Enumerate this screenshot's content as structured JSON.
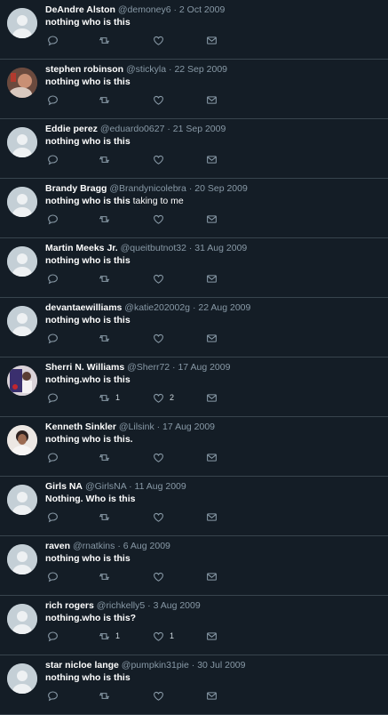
{
  "tweets": [
    {
      "name": "DeAndre Alston",
      "handle": "@demoney6",
      "date": "2 Oct 2009",
      "text_bold": "nothing who is this",
      "text_rest": "",
      "retweets": "",
      "likes": ""
    },
    {
      "name": "stephen robinson",
      "handle": "@stickyla",
      "date": "22 Sep 2009",
      "text_bold": "nothing who is this",
      "text_rest": "",
      "retweets": "",
      "likes": ""
    },
    {
      "name": "Eddie perez",
      "handle": "@eduardo0627",
      "date": "21 Sep 2009",
      "text_bold": "nothing who is this",
      "text_rest": "",
      "retweets": "",
      "likes": ""
    },
    {
      "name": "Brandy Bragg",
      "handle": "@Brandynicolebra",
      "date": "20 Sep 2009",
      "text_bold": "nothing who is this",
      "text_rest": " taking to me",
      "retweets": "",
      "likes": ""
    },
    {
      "name": "Martin Meeks Jr.",
      "handle": "@queitbutnot32",
      "date": "31 Aug 2009",
      "text_bold": "nothing who is this",
      "text_rest": "",
      "retweets": "",
      "likes": ""
    },
    {
      "name": "devantaewilliams",
      "handle": "@katie202002g",
      "date": "22 Aug 2009",
      "text_bold": "nothing who is this",
      "text_rest": "",
      "retweets": "",
      "likes": ""
    },
    {
      "name": "Sherri N. Williams",
      "handle": "@Sherr72",
      "date": "17 Aug 2009",
      "text_bold": "nothing.who is this",
      "text_rest": "",
      "retweets": "1",
      "likes": "2"
    },
    {
      "name": "Kenneth Sinkler",
      "handle": "@Lilsink",
      "date": "17 Aug 2009",
      "text_bold": "nothing who is this.",
      "text_rest": "",
      "retweets": "",
      "likes": ""
    },
    {
      "name": "Girls NA",
      "handle": "@GirlsNA",
      "date": "11 Aug 2009",
      "text_bold": "Nothing. Who is this",
      "text_rest": "",
      "retweets": "",
      "likes": ""
    },
    {
      "name": "raven",
      "handle": "@rnatkins",
      "date": "6 Aug 2009",
      "text_bold": "nothing who is this",
      "text_rest": "",
      "retweets": "",
      "likes": ""
    },
    {
      "name": "rich rogers",
      "handle": "@richkelly5",
      "date": "3 Aug 2009",
      "text_bold": "nothing.who is this?",
      "text_rest": "",
      "retweets": "1",
      "likes": "1"
    },
    {
      "name": "star nicloe lange",
      "handle": "@pumpkin31pie",
      "date": "30 Jul 2009",
      "text_bold": "nothing who is this",
      "text_rest": "",
      "retweets": "",
      "likes": ""
    }
  ],
  "separator": "·",
  "icons": {
    "reply": "reply-icon",
    "retweet": "retweet-icon",
    "like": "heart-icon",
    "message": "envelope-icon"
  },
  "colors": {
    "background": "#141d26",
    "muted": "#8899a6",
    "divider": "#38444d"
  }
}
